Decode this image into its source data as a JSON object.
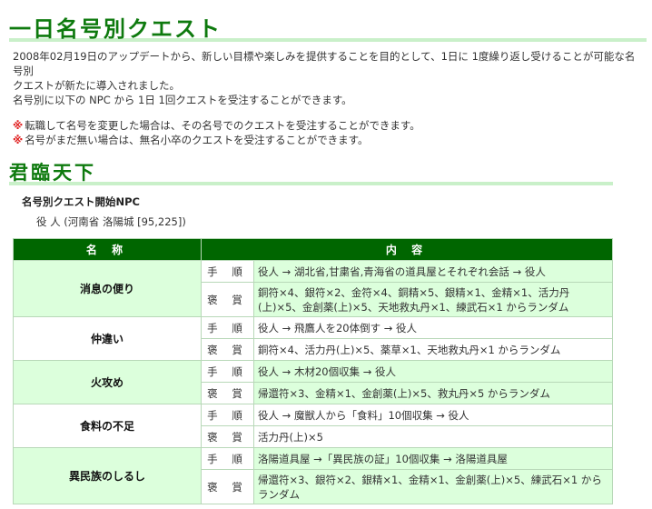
{
  "header": {
    "title": "一日名号別クエスト"
  },
  "intro": {
    "line1": "2008年02月19日のアップデートから、新しい目標や楽しみを提供することを目的として、1日に 1度繰り返し受けることが可能な名号別",
    "line2": "クエストが新たに導入されました。",
    "line3": "名号別に以下の NPC から 1日 1回クエストを受注することができます。"
  },
  "notes": {
    "mark": "※",
    "items": [
      "転職して名号を変更した場合は、その名号でのクエストを受注することができます。",
      "名号がまだ無い場合は、無名小卒のクエストを受注することができます。"
    ]
  },
  "section": {
    "title": "君臨天下",
    "npc_title": "名号別クエスト開始NPC",
    "npc_location": "役 人 (河南省 洛陽城 [95,225])"
  },
  "table": {
    "headers": {
      "name": "名 称",
      "content": "内 容"
    },
    "row_labels": {
      "procedure": "手 順",
      "reward": "褒 賞"
    },
    "quests": [
      {
        "name": "消息の便り",
        "procedure": "役人 → 湖北省,甘粛省,青海省の道具屋とそれぞれ会話 → 役人",
        "reward": "銅符×4、銀符×2、金符×4、銅精×5、銀精×1、金精×1、活力丹(上)×5、金創薬(上)×5、天地救丸丹×1、練武石×1 からランダム"
      },
      {
        "name": "仲違い",
        "procedure": "役人 → 飛鷹人を20体倒す → 役人",
        "reward": "銅符×4、活力丹(上)×5、薬草×1、天地救丸丹×1 からランダム"
      },
      {
        "name": "火攻め",
        "procedure": "役人 → 木材20個収集 → 役人",
        "reward": "帰還符×3、金精×1、金創薬(上)×5、救丸丹×5 からランダム"
      },
      {
        "name": "食料の不足",
        "procedure": "役人 → 魔獣人から「食料」10個収集 → 役人",
        "reward": "活力丹(上)×5"
      },
      {
        "name": "異民族のしるし",
        "procedure": "洛陽道具屋 →「異民族の証」10個収集 → 洛陽道具屋",
        "reward": "帰還符×3、銀符×2、銀精×1、金精×1、金創薬(上)×5、練武石×1 からランダム"
      }
    ]
  },
  "colors": {
    "title_green": "#0e7a0e",
    "header_bg": "#006600",
    "row_highlight": "#dcffdc",
    "note_mark": "#e02020",
    "underline": "#c9f0c9"
  }
}
